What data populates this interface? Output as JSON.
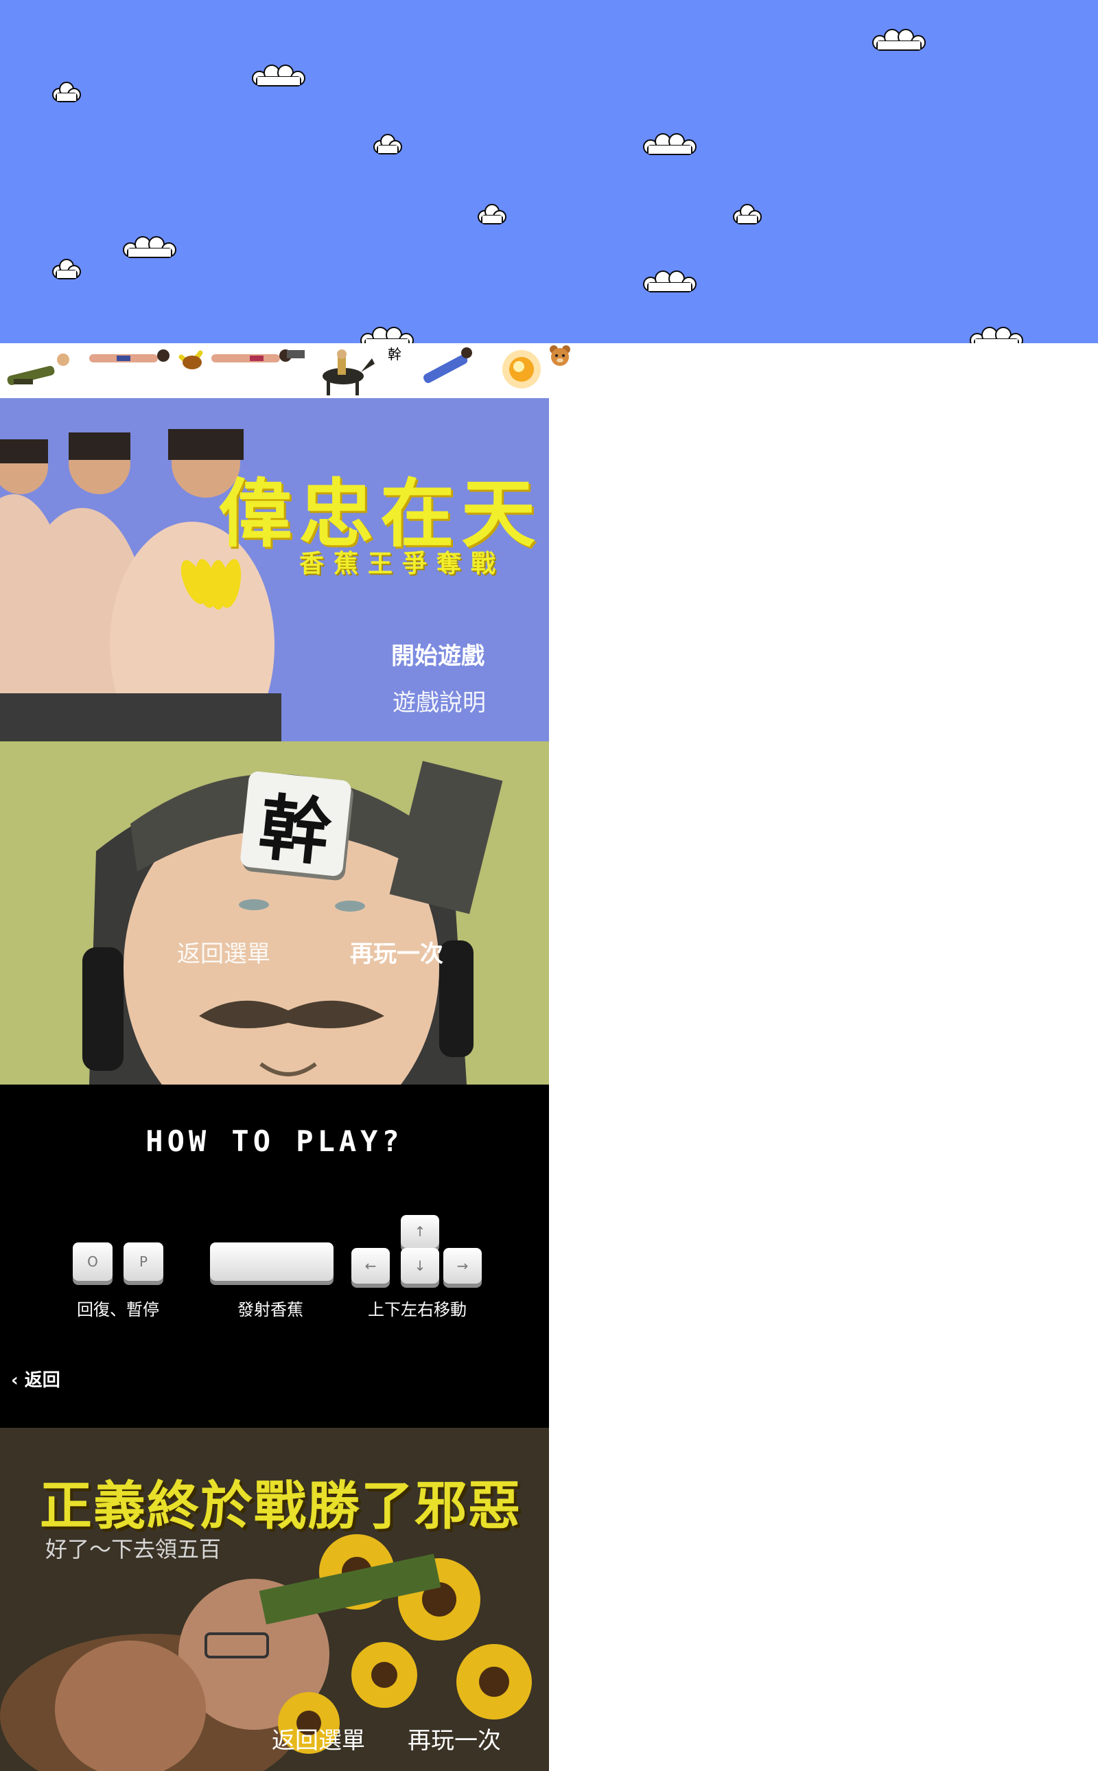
{
  "sky": {
    "color": "#6a8dfc"
  },
  "sprite_strip": {
    "label": "幹"
  },
  "title_screen": {
    "title": "偉忠在天",
    "subtitle": "香蕉王爭奪戰",
    "start_label": "開始遊戲",
    "howto_label": "遊戲說明"
  },
  "gameover_screen": {
    "tile_char": "幹",
    "back_label": "返回選單",
    "retry_label": "再玩一次"
  },
  "howto_screen": {
    "title": "HOW TO PLAY?",
    "keys": {
      "o": "O",
      "p": "P",
      "up": "↑",
      "down": "↓",
      "left": "←",
      "right": "→"
    },
    "captions": {
      "pause": "回復、暫停",
      "fire": "發射香蕉",
      "move": "上下左右移動"
    },
    "back_label": "返回"
  },
  "victory_screen": {
    "title": "正義終於戰勝了邪惡",
    "subtitle": "好了～下去領五百",
    "back_label": "返回選單",
    "retry_label": "再玩一次"
  },
  "colors": {
    "sky": "#6a8dfc",
    "title_yellow": "#f1ee2c",
    "title_panel_bg": "#7c8bdf",
    "gameover_bg": "#b9bf73"
  }
}
